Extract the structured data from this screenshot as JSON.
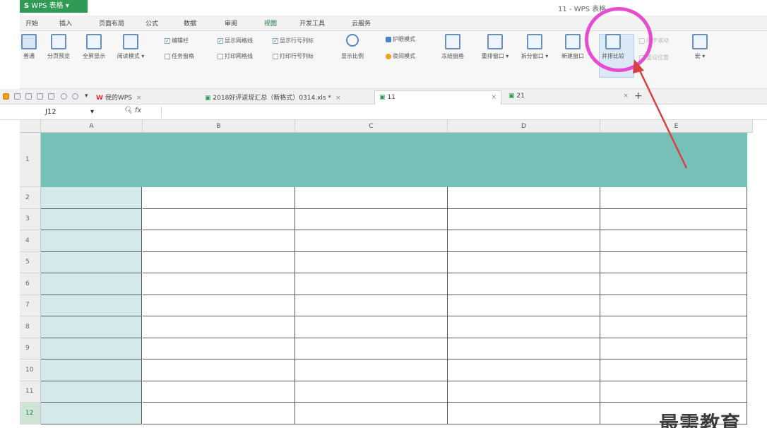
{
  "app": {
    "name": "WPS 表格",
    "window_title": "11 - WPS 表格"
  },
  "menu_tabs": [
    "开始",
    "插入",
    "页面布局",
    "公式",
    "数据",
    "审阅",
    "视图",
    "开发工具",
    "云服务"
  ],
  "active_menu_tab": "视图",
  "ribbon": {
    "normal": "普通",
    "page_break_preview": "分页预览",
    "full_screen": "全屏显示",
    "reading_mode": "阅读模式",
    "edit_bar": "编辑栏",
    "task_pane": "任务窗格",
    "show_gridlines": "显示网格线",
    "print_gridlines": "打印网格线",
    "show_row_col_headers": "显示行号列标",
    "print_row_col_headers": "打印行号列标",
    "zoom": "显示比例",
    "eye_protection": "护眼模式",
    "night_mode": "夜间模式",
    "freeze_panes": "冻结窗格",
    "arrange_windows": "重排窗口",
    "split_window": "拆分窗口",
    "new_window": "新建窗口",
    "side_by_side": "并排比较",
    "sync_scroll": "同步滚动",
    "reset_position": "重设位置",
    "more": "宏"
  },
  "doc_tabs": {
    "my_wps": "我的WPS",
    "doc1": "2018好评返现汇总（新格式）0314.xls *",
    "doc2": "11",
    "doc3": "21",
    "close": "×",
    "new": "+"
  },
  "formula_bar": {
    "cell_ref": "J12",
    "fx": "fx",
    "value": ""
  },
  "columns": [
    "A",
    "B",
    "C",
    "D",
    "E"
  ],
  "rows": [
    "1",
    "2",
    "3",
    "4",
    "5",
    "6",
    "7",
    "8",
    "9",
    "10",
    "11",
    "12"
  ],
  "selected_row": "12",
  "colors": {
    "title_band": "#77bfb9",
    "col_a_fill": "#d4eaea",
    "highlight_circle": "#e64bd2",
    "arrow": "#d94040"
  },
  "watermark": "最需教育"
}
